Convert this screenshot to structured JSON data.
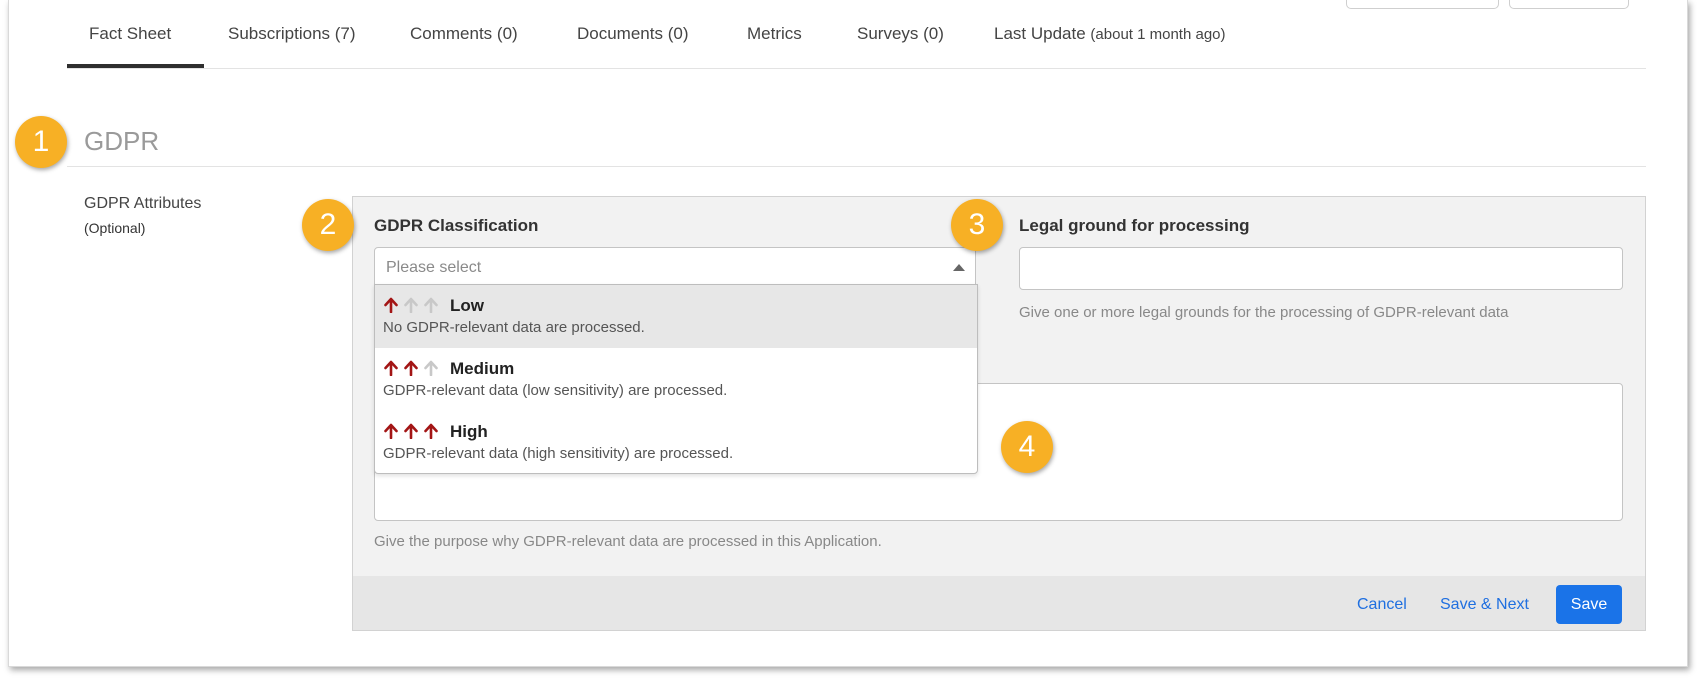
{
  "tabs": [
    {
      "label": "Fact Sheet"
    },
    {
      "label": "Subscriptions (7)"
    },
    {
      "label": "Comments (0)"
    },
    {
      "label": "Documents (0)"
    },
    {
      "label": "Metrics"
    },
    {
      "label": "Surveys (0)"
    },
    {
      "label": "Last Update",
      "sub": "(about 1 month ago)"
    }
  ],
  "section": {
    "title": "GDPR"
  },
  "attributes": {
    "label": "GDPR Attributes",
    "optional": "(Optional)"
  },
  "badges": [
    "1",
    "2",
    "3",
    "4"
  ],
  "classification": {
    "label": "GDPR Classification",
    "placeholder": "Please select",
    "options": [
      {
        "title": "Low",
        "desc": "No GDPR-relevant data are processed.",
        "level": 1
      },
      {
        "title": "Medium",
        "desc": "GDPR-relevant data (low sensitivity) are processed.",
        "level": 2
      },
      {
        "title": "High",
        "desc": "GDPR-relevant data (high sensitivity) are processed.",
        "level": 3
      }
    ]
  },
  "legal": {
    "label": "Legal ground for processing",
    "value": "",
    "help": "Give one or more legal grounds for the processing of GDPR-relevant data"
  },
  "purpose": {
    "value": "",
    "help": "Give the purpose why GDPR-relevant data are processed in this Application."
  },
  "actions": {
    "cancel": "Cancel",
    "save_next": "Save & Next",
    "save": "Save"
  },
  "colors": {
    "accent": "#1a73e8",
    "badge": "#f7b025",
    "arrow_active": "#a31515",
    "arrow_inactive": "#c8c8c8"
  }
}
